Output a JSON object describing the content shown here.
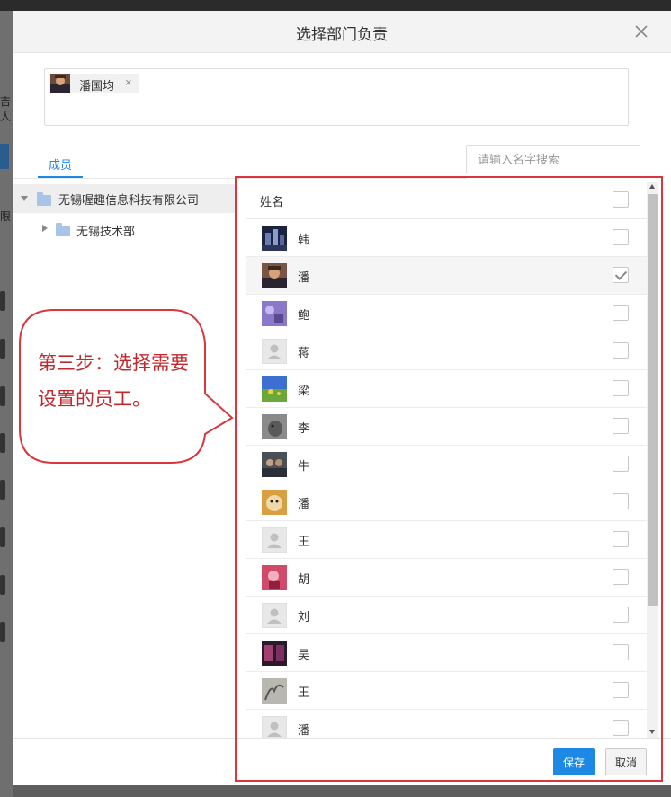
{
  "background": {
    "left_fragments": [
      "吉人",
      "限"
    ]
  },
  "dialog": {
    "title": "选择部门负责",
    "close_icon": "close-icon",
    "selected": [
      {
        "name": "潘国均",
        "remove_icon": "×"
      }
    ]
  },
  "tabs": [
    {
      "label": "成员",
      "active": true
    }
  ],
  "search": {
    "placeholder": "请输入名字搜索",
    "value": ""
  },
  "tree": {
    "root": {
      "label": "无锡喔趣信息科技有限公司",
      "expanded": true,
      "icon": "folder-icon"
    },
    "children": [
      {
        "label": "无锡技术部",
        "expanded": false,
        "icon": "folder-icon"
      }
    ]
  },
  "member_list": {
    "header": "姓名",
    "rows": [
      {
        "name": "韩",
        "checked": false,
        "avatar": "photo-night-city"
      },
      {
        "name": "潘",
        "checked": true,
        "avatar": "photo-person"
      },
      {
        "name": "鲍",
        "checked": false,
        "avatar": "photo-purple"
      },
      {
        "name": "蒋",
        "checked": false,
        "avatar": "default-avatar"
      },
      {
        "name": "梁",
        "checked": false,
        "avatar": "photo-field"
      },
      {
        "name": "李",
        "checked": false,
        "avatar": "photo-animal"
      },
      {
        "name": "牛",
        "checked": false,
        "avatar": "photo-group"
      },
      {
        "name": "潘",
        "checked": false,
        "avatar": "photo-dog"
      },
      {
        "name": "王",
        "checked": false,
        "avatar": "default-avatar"
      },
      {
        "name": "胡",
        "checked": false,
        "avatar": "photo-pink"
      },
      {
        "name": "刘",
        "checked": false,
        "avatar": "default-avatar"
      },
      {
        "name": "吴",
        "checked": false,
        "avatar": "photo-dark"
      },
      {
        "name": "王",
        "checked": false,
        "avatar": "photo-sketch"
      },
      {
        "name": "潘",
        "checked": false,
        "avatar": "default-avatar"
      }
    ]
  },
  "buttons": {
    "save": "保存",
    "cancel": "取消"
  },
  "annotation": {
    "text": "第三步：选择需要设置的员工。",
    "color": "#c0282e"
  },
  "colors": {
    "accent": "#1e88e5",
    "annotation_red": "#d9363e"
  }
}
